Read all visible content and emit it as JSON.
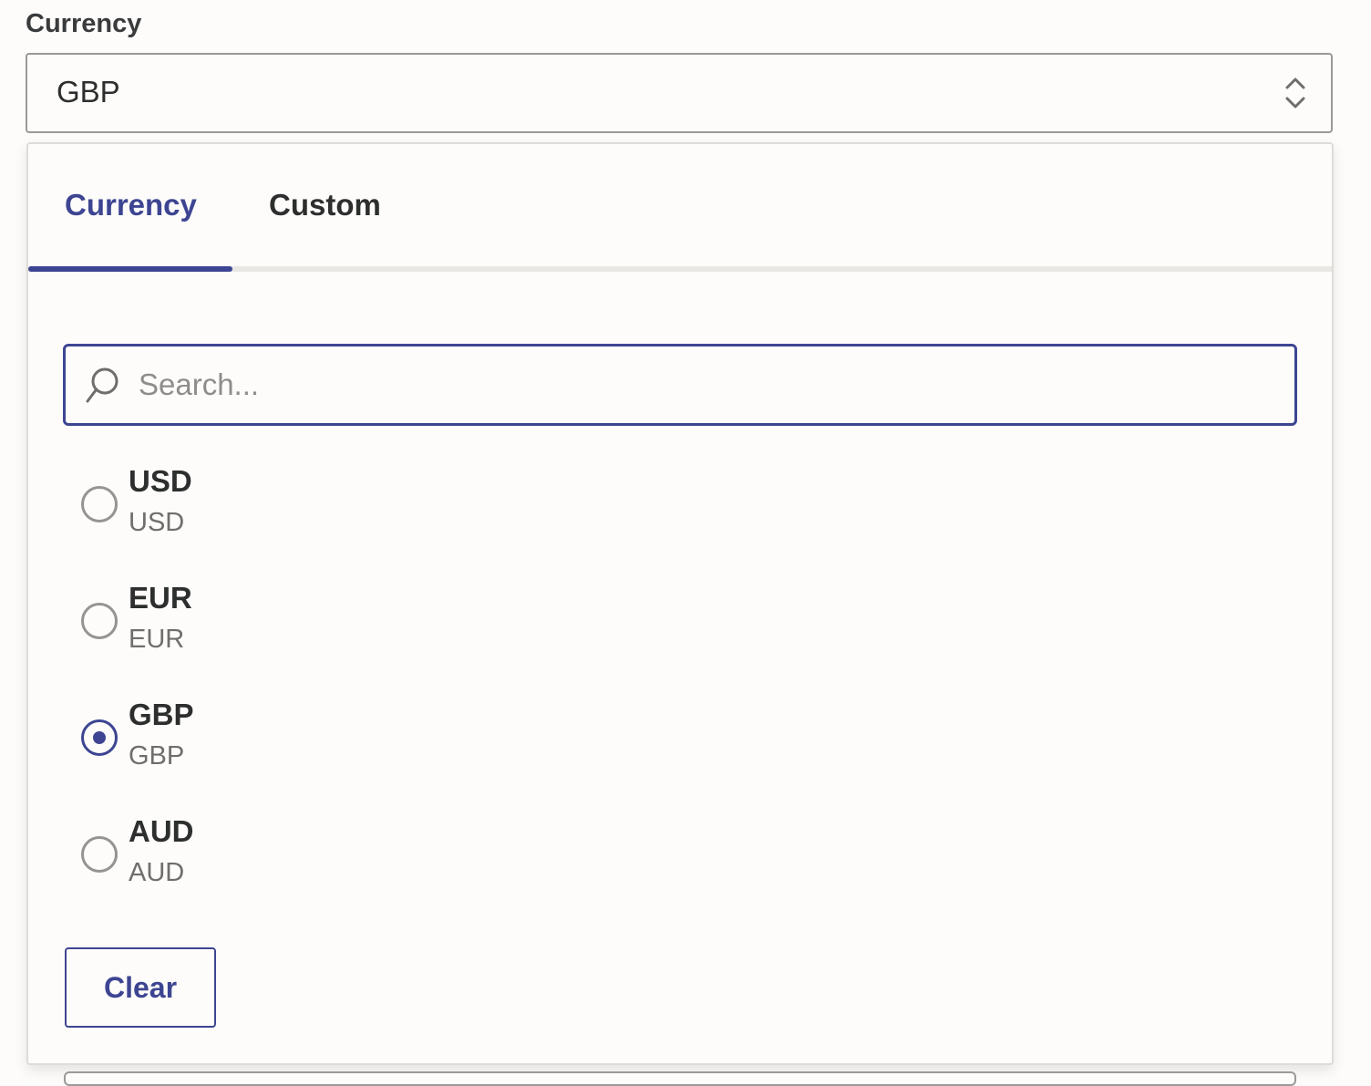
{
  "field": {
    "label": "Currency",
    "selected_value": "GBP"
  },
  "tabs": [
    {
      "label": "Currency",
      "active": true
    },
    {
      "label": "Custom",
      "active": false
    }
  ],
  "search": {
    "value": "",
    "placeholder": "Search..."
  },
  "options": [
    {
      "title": "USD",
      "subtitle": "USD",
      "selected": false
    },
    {
      "title": "EUR",
      "subtitle": "EUR",
      "selected": false
    },
    {
      "title": "GBP",
      "subtitle": "GBP",
      "selected": true
    },
    {
      "title": "AUD",
      "subtitle": "AUD",
      "selected": false
    }
  ],
  "actions": {
    "clear_label": "Clear"
  },
  "colors": {
    "accent": "#3d4592",
    "text": "#2d2e2e",
    "muted": "#6f6e6c",
    "border": "#9a9998",
    "background": "#fdfcfa"
  },
  "icons": {
    "select": "chevron-up-down-icon",
    "search": "search-icon"
  }
}
